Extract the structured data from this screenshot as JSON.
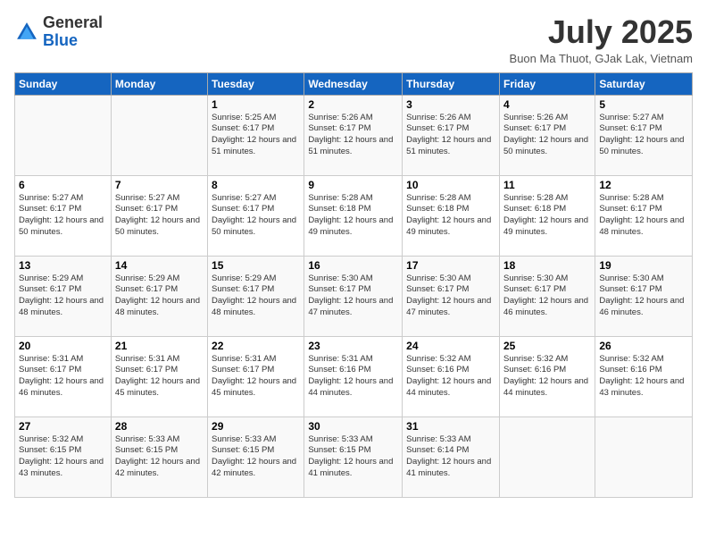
{
  "header": {
    "logo": {
      "general": "General",
      "blue": "Blue"
    },
    "title": "July 2025",
    "location": "Buon Ma Thuot, GJak Lak, Vietnam"
  },
  "weekdays": [
    "Sunday",
    "Monday",
    "Tuesday",
    "Wednesday",
    "Thursday",
    "Friday",
    "Saturday"
  ],
  "weeks": [
    [
      {
        "day": "",
        "info": ""
      },
      {
        "day": "",
        "info": ""
      },
      {
        "day": "1",
        "info": "Sunrise: 5:25 AM\nSunset: 6:17 PM\nDaylight: 12 hours and 51 minutes."
      },
      {
        "day": "2",
        "info": "Sunrise: 5:26 AM\nSunset: 6:17 PM\nDaylight: 12 hours and 51 minutes."
      },
      {
        "day": "3",
        "info": "Sunrise: 5:26 AM\nSunset: 6:17 PM\nDaylight: 12 hours and 51 minutes."
      },
      {
        "day": "4",
        "info": "Sunrise: 5:26 AM\nSunset: 6:17 PM\nDaylight: 12 hours and 50 minutes."
      },
      {
        "day": "5",
        "info": "Sunrise: 5:27 AM\nSunset: 6:17 PM\nDaylight: 12 hours and 50 minutes."
      }
    ],
    [
      {
        "day": "6",
        "info": "Sunrise: 5:27 AM\nSunset: 6:17 PM\nDaylight: 12 hours and 50 minutes."
      },
      {
        "day": "7",
        "info": "Sunrise: 5:27 AM\nSunset: 6:17 PM\nDaylight: 12 hours and 50 minutes."
      },
      {
        "day": "8",
        "info": "Sunrise: 5:27 AM\nSunset: 6:17 PM\nDaylight: 12 hours and 50 minutes."
      },
      {
        "day": "9",
        "info": "Sunrise: 5:28 AM\nSunset: 6:18 PM\nDaylight: 12 hours and 49 minutes."
      },
      {
        "day": "10",
        "info": "Sunrise: 5:28 AM\nSunset: 6:18 PM\nDaylight: 12 hours and 49 minutes."
      },
      {
        "day": "11",
        "info": "Sunrise: 5:28 AM\nSunset: 6:18 PM\nDaylight: 12 hours and 49 minutes."
      },
      {
        "day": "12",
        "info": "Sunrise: 5:28 AM\nSunset: 6:17 PM\nDaylight: 12 hours and 48 minutes."
      }
    ],
    [
      {
        "day": "13",
        "info": "Sunrise: 5:29 AM\nSunset: 6:17 PM\nDaylight: 12 hours and 48 minutes."
      },
      {
        "day": "14",
        "info": "Sunrise: 5:29 AM\nSunset: 6:17 PM\nDaylight: 12 hours and 48 minutes."
      },
      {
        "day": "15",
        "info": "Sunrise: 5:29 AM\nSunset: 6:17 PM\nDaylight: 12 hours and 48 minutes."
      },
      {
        "day": "16",
        "info": "Sunrise: 5:30 AM\nSunset: 6:17 PM\nDaylight: 12 hours and 47 minutes."
      },
      {
        "day": "17",
        "info": "Sunrise: 5:30 AM\nSunset: 6:17 PM\nDaylight: 12 hours and 47 minutes."
      },
      {
        "day": "18",
        "info": "Sunrise: 5:30 AM\nSunset: 6:17 PM\nDaylight: 12 hours and 46 minutes."
      },
      {
        "day": "19",
        "info": "Sunrise: 5:30 AM\nSunset: 6:17 PM\nDaylight: 12 hours and 46 minutes."
      }
    ],
    [
      {
        "day": "20",
        "info": "Sunrise: 5:31 AM\nSunset: 6:17 PM\nDaylight: 12 hours and 46 minutes."
      },
      {
        "day": "21",
        "info": "Sunrise: 5:31 AM\nSunset: 6:17 PM\nDaylight: 12 hours and 45 minutes."
      },
      {
        "day": "22",
        "info": "Sunrise: 5:31 AM\nSunset: 6:17 PM\nDaylight: 12 hours and 45 minutes."
      },
      {
        "day": "23",
        "info": "Sunrise: 5:31 AM\nSunset: 6:16 PM\nDaylight: 12 hours and 44 minutes."
      },
      {
        "day": "24",
        "info": "Sunrise: 5:32 AM\nSunset: 6:16 PM\nDaylight: 12 hours and 44 minutes."
      },
      {
        "day": "25",
        "info": "Sunrise: 5:32 AM\nSunset: 6:16 PM\nDaylight: 12 hours and 44 minutes."
      },
      {
        "day": "26",
        "info": "Sunrise: 5:32 AM\nSunset: 6:16 PM\nDaylight: 12 hours and 43 minutes."
      }
    ],
    [
      {
        "day": "27",
        "info": "Sunrise: 5:32 AM\nSunset: 6:15 PM\nDaylight: 12 hours and 43 minutes."
      },
      {
        "day": "28",
        "info": "Sunrise: 5:33 AM\nSunset: 6:15 PM\nDaylight: 12 hours and 42 minutes."
      },
      {
        "day": "29",
        "info": "Sunrise: 5:33 AM\nSunset: 6:15 PM\nDaylight: 12 hours and 42 minutes."
      },
      {
        "day": "30",
        "info": "Sunrise: 5:33 AM\nSunset: 6:15 PM\nDaylight: 12 hours and 41 minutes."
      },
      {
        "day": "31",
        "info": "Sunrise: 5:33 AM\nSunset: 6:14 PM\nDaylight: 12 hours and 41 minutes."
      },
      {
        "day": "",
        "info": ""
      },
      {
        "day": "",
        "info": ""
      }
    ]
  ]
}
